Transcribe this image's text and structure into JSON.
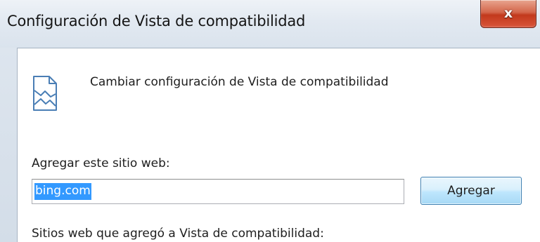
{
  "window": {
    "title": "Configuración de Vista de compatibilidad",
    "close_label": "x"
  },
  "header": {
    "icon": "compatibility-view-icon",
    "label": "Cambiar configuración de Vista de compatibilidad"
  },
  "add_site": {
    "label": "Agregar este sitio web:",
    "input_value": "bing.com",
    "button_label": "Agregar"
  },
  "sites_list": {
    "label": "Sitios web que agregó a Vista de compatibilidad:"
  },
  "colors": {
    "selection": "#3399ff",
    "close_button": "#c2391c",
    "button_border": "#3c7fb1"
  }
}
